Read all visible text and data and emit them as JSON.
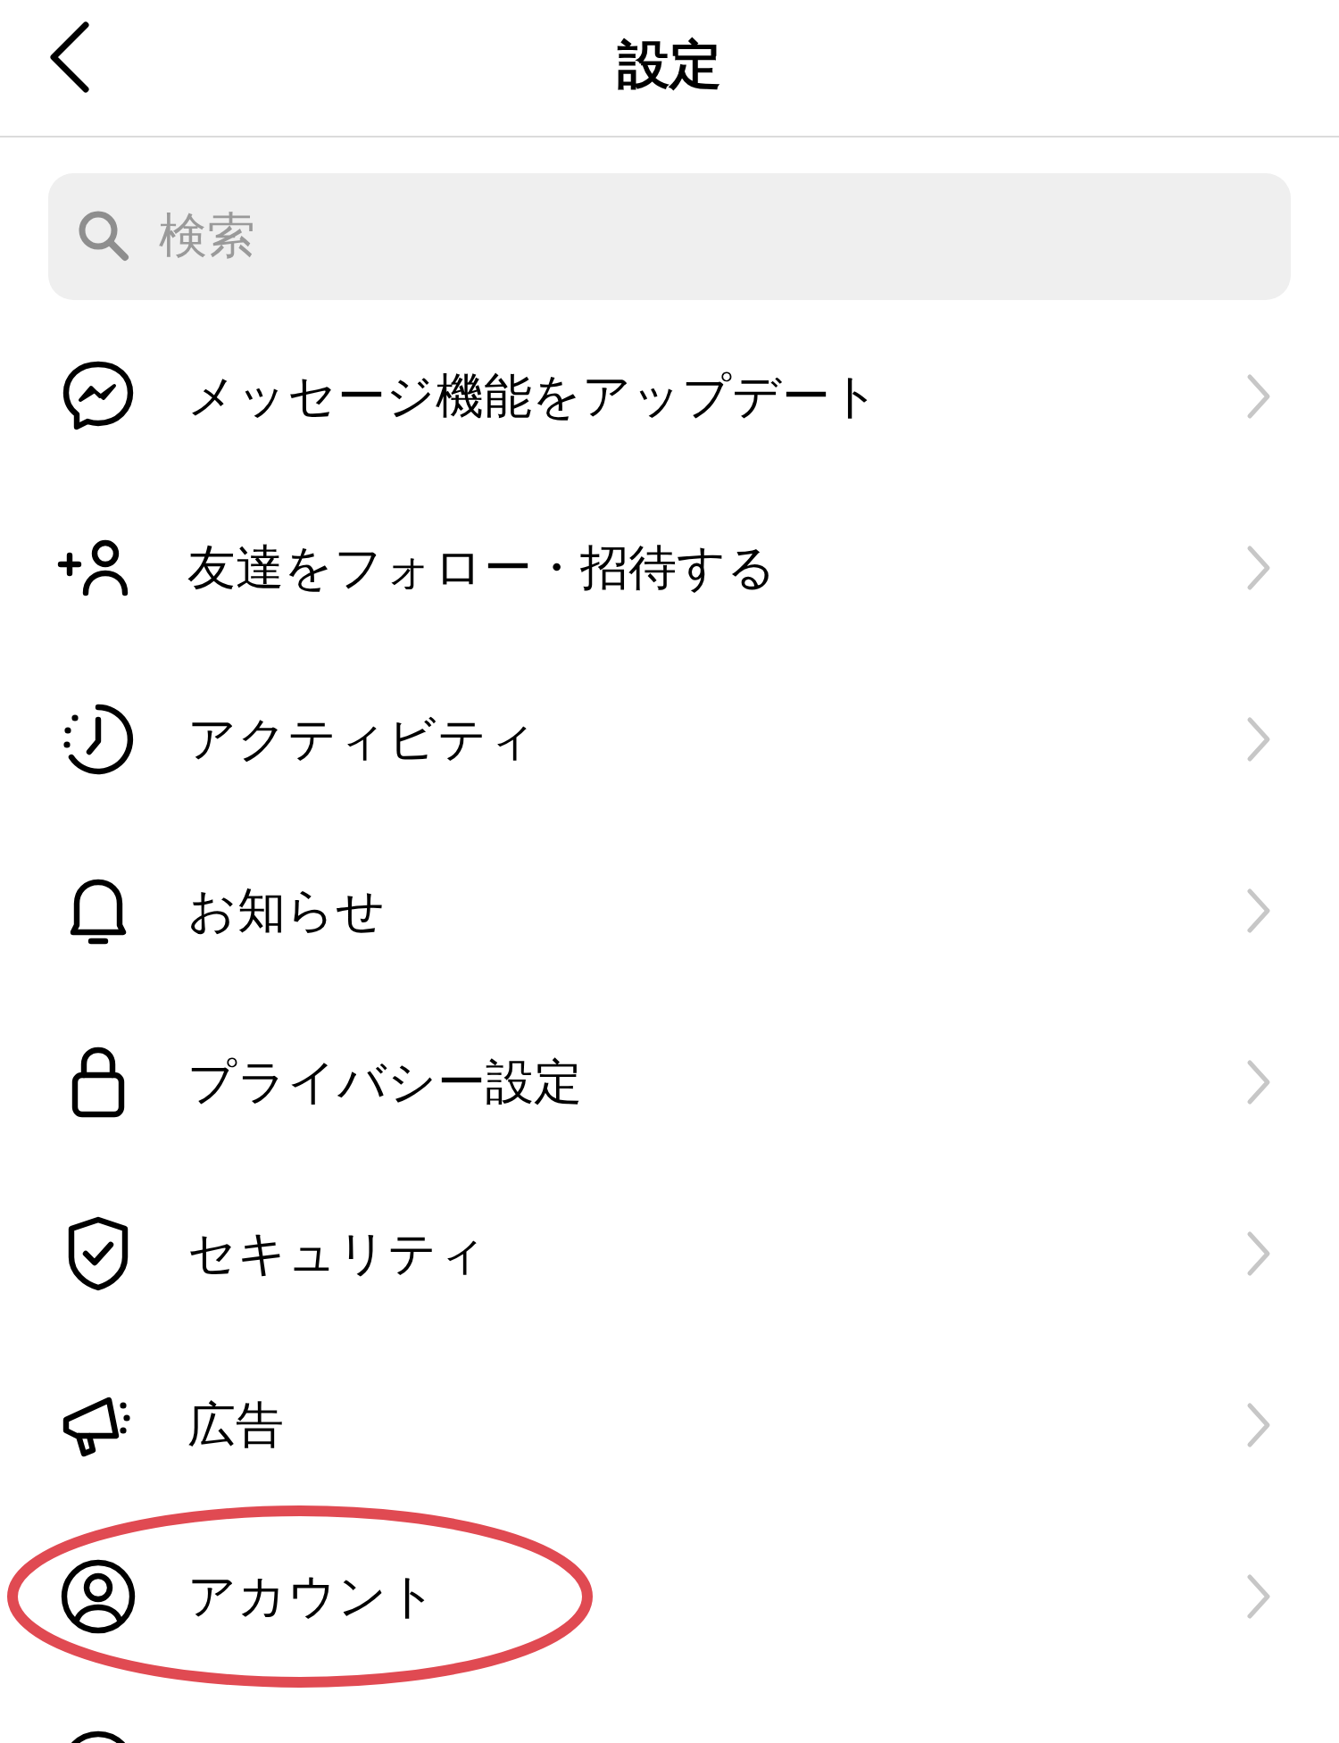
{
  "header": {
    "title": "設定"
  },
  "search": {
    "placeholder": "検索"
  },
  "items": [
    {
      "label": "メッセージ機能をアップデート",
      "highlighted": false
    },
    {
      "label": "友達をフォロー・招待する",
      "highlighted": false
    },
    {
      "label": "アクティビティ",
      "highlighted": false
    },
    {
      "label": "お知らせ",
      "highlighted": false
    },
    {
      "label": "プライバシー設定",
      "highlighted": false
    },
    {
      "label": "セキュリティ",
      "highlighted": false
    },
    {
      "label": "広告",
      "highlighted": false
    },
    {
      "label": "アカウント",
      "highlighted": true
    }
  ]
}
